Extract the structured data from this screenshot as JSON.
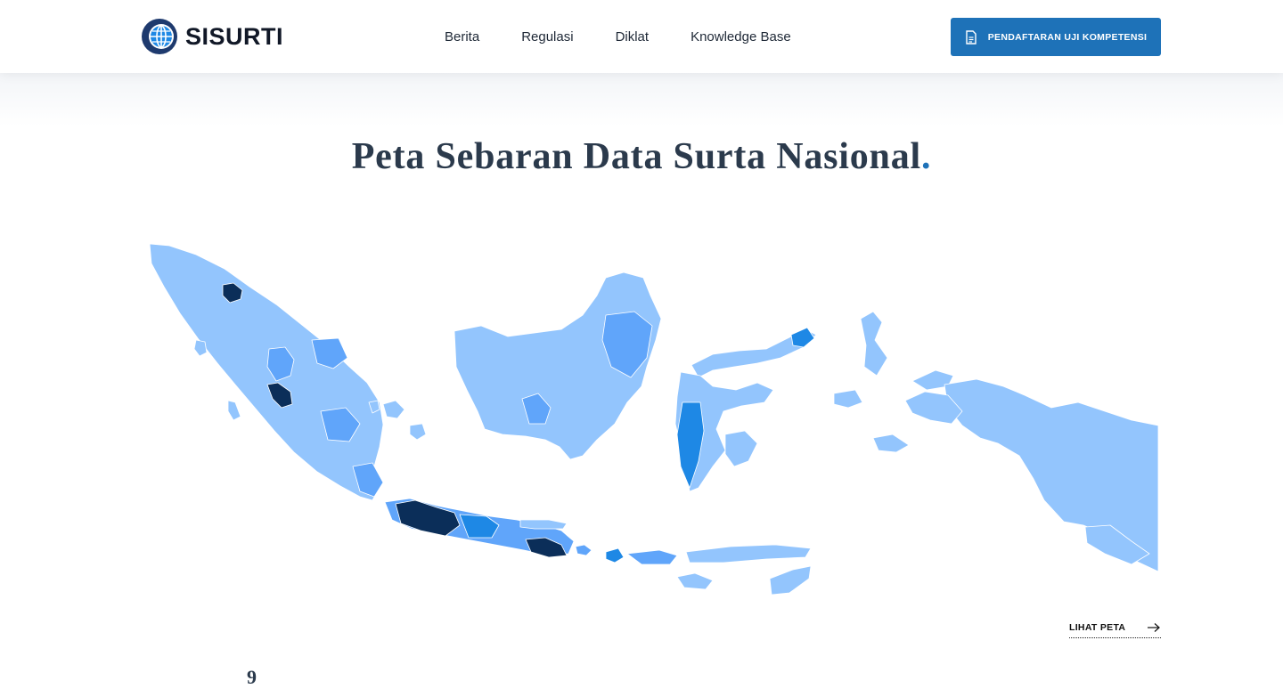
{
  "brand": {
    "name": "SISURTI",
    "logo_icon": "globe-logo-icon"
  },
  "nav": {
    "items": [
      {
        "label": "Berita"
      },
      {
        "label": "Regulasi"
      },
      {
        "label": "Diklat"
      },
      {
        "label": "Knowledge Base"
      }
    ]
  },
  "cta": {
    "label": "PENDAFTARAN UJI KOMPETENSI",
    "icon": "document-icon"
  },
  "hero": {
    "title": "Peta Sebaran Data Surta Nasional",
    "title_suffix": "."
  },
  "map": {
    "legend_colors": {
      "low": "#93c5fd",
      "medium": "#60a5fa",
      "high": "#1e88e5",
      "highest": "#0b2e59"
    }
  },
  "more_link": {
    "label": "LIHAT PETA",
    "icon": "arrow-right-icon"
  },
  "next_section": {
    "glyph": "9"
  },
  "colors": {
    "accent": "#1e72b8",
    "title": "#2b3a4c"
  }
}
